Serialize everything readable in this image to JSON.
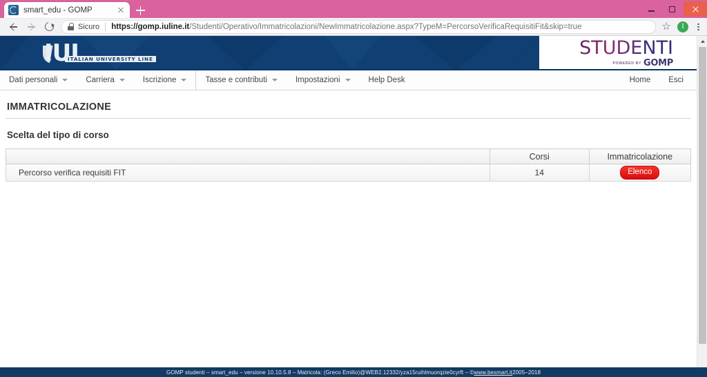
{
  "browser": {
    "tab": {
      "title": "smart_edu - GOMP",
      "favicon": "gomp-favicon",
      "close": "×"
    },
    "newtab_label": "+",
    "window": {
      "minimize": "–",
      "maximize": "❐",
      "close": "✕"
    },
    "nav": {
      "back": "←",
      "forward": "→",
      "reload": "⟳"
    },
    "omnibox": {
      "secure_label": "Sicuro",
      "url_domain": "https://gomp.iuline.it",
      "url_path": "/Studenti/Operativo/Immatricolazioni/NewImmatricolazione.aspx?TypeM=PercorsoVerificaRequisitiFit&skip=true",
      "url_full": "https://gomp.iuline.it/Studenti/Operativo/Immatricolazioni/NewImmatricolazione.aspx?TypeM=PercorsoVerificaRequisitiFit&skip=true"
    },
    "bookmark_icon": "☆",
    "profile_initial": "I"
  },
  "header": {
    "logo_primary": "IUL",
    "logo_subtitle": "ITALIAN UNIVERSITY LINE",
    "logo_secondary": "STUDENTI",
    "powered_by": "POWERED BY",
    "gomp": "GOMP",
    "gomp_sup": "P"
  },
  "nav": {
    "items": [
      {
        "label": "Dati personali",
        "has_caret": true
      },
      {
        "label": "Carriera",
        "has_caret": true
      },
      {
        "label": "Iscrizione",
        "has_caret": true
      },
      {
        "label": "Tasse e contributi",
        "has_caret": true
      },
      {
        "label": "Impostazioni",
        "has_caret": true
      },
      {
        "label": "Help Desk",
        "has_caret": false
      }
    ],
    "right_items": [
      {
        "label": "Home"
      },
      {
        "label": "Esci"
      }
    ]
  },
  "main": {
    "page_title": "IMMATRICOLAZIONE",
    "section_title": "Scelta del tipo di corso",
    "table": {
      "headers": [
        "",
        "Corsi",
        "Immatricolazione"
      ],
      "rows": [
        {
          "name": "Percorso verifica requisiti FIT",
          "corsi": "14",
          "action": "Elenco"
        }
      ]
    }
  },
  "footer": {
    "text_before_link": "GOMP studenti – smart_edu – versione 10.10.5.8 – Matricola: (Greco Emilio)@WEB2.12332/yza15ruihlmuorqzie0cyrft – © ",
    "link": "www.besmart.it",
    "text_after_link": " 2005–2018"
  },
  "colors": {
    "accent_pink": "#d9629f",
    "banner_blue": "#103f73",
    "footer_blue": "#123a63",
    "button_red": "#d70d0d",
    "profile_green": "#3aa757"
  }
}
